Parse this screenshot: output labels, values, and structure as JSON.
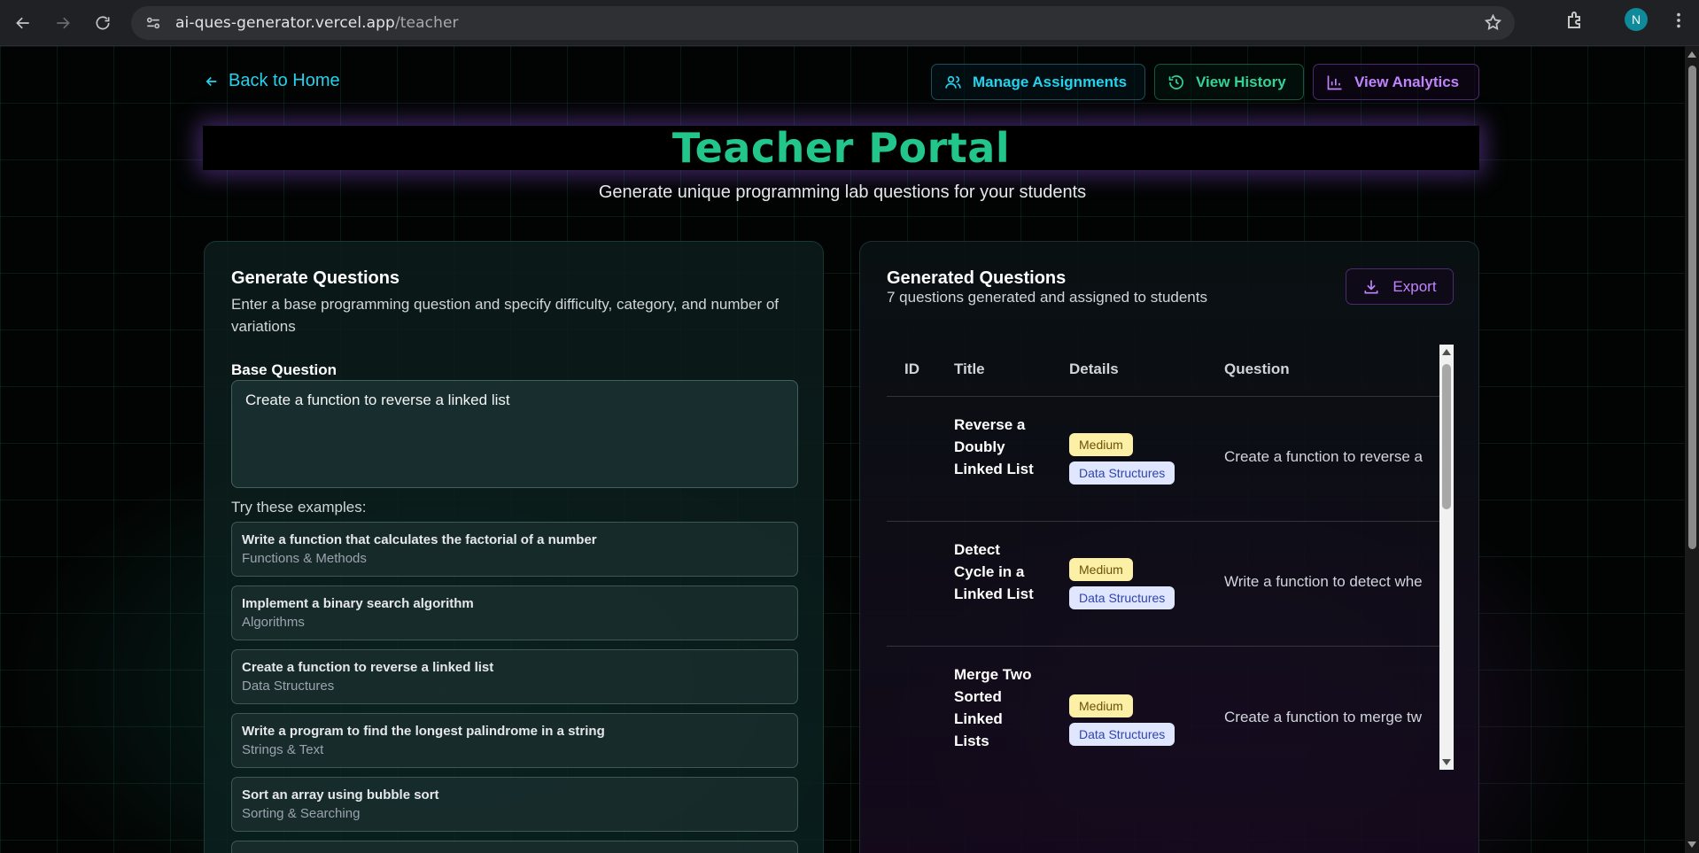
{
  "browser": {
    "url_domain": "ai-ques-generator.vercel.app",
    "url_path": "/teacher",
    "avatar_initial": "N"
  },
  "nav": {
    "back_label": "Back to Home",
    "manage_label": "Manage Assignments",
    "history_label": "View History",
    "analytics_label": "View Analytics"
  },
  "header": {
    "title": "Teacher Portal",
    "subtitle": "Generate unique programming lab questions for your students"
  },
  "generate": {
    "title": "Generate Questions",
    "description": "Enter a base programming question and specify difficulty, category, and number of variations",
    "base_label": "Base Question",
    "base_value": "Create a function to reverse a linked list",
    "examples_label": "Try these examples:",
    "examples": [
      {
        "title": "Write a function that calculates the factorial of a number",
        "category": "Functions & Methods"
      },
      {
        "title": "Implement a binary search algorithm",
        "category": "Algorithms"
      },
      {
        "title": "Create a function to reverse a linked list",
        "category": "Data Structures"
      },
      {
        "title": "Write a program to find the longest palindrome in a string",
        "category": "Strings & Text"
      },
      {
        "title": "Sort an array using bubble sort",
        "category": "Sorting & Searching"
      }
    ]
  },
  "generated": {
    "title": "Generated Questions",
    "summary": "7 questions generated and assigned to students",
    "export_label": "Export",
    "columns": [
      "ID",
      "Title",
      "Details",
      "Question"
    ],
    "rows": [
      {
        "title": "Reverse a Doubly Linked List",
        "difficulty": "Medium",
        "category": "Data Structures",
        "question": "Create a function to reverse a"
      },
      {
        "title": "Detect Cycle in a Linked List",
        "difficulty": "Medium",
        "category": "Data Structures",
        "question": "Write a function to detect whe"
      },
      {
        "title": "Merge Two Sorted Linked Lists",
        "difficulty": "Medium",
        "category": "Data Structures",
        "question": "Create a function to merge tw"
      }
    ]
  },
  "colors": {
    "accent_cyan": "#22d3ee",
    "accent_green": "#34d399",
    "accent_purple": "#c084fc",
    "title_green": "#22c58a"
  }
}
